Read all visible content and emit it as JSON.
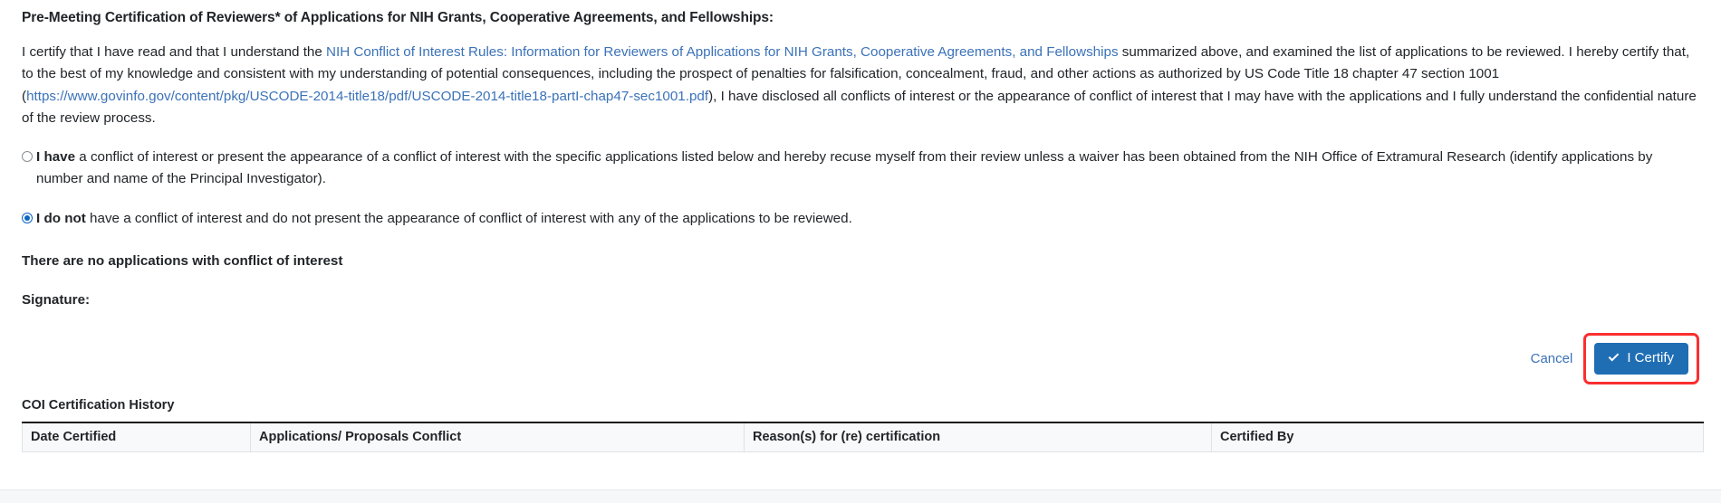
{
  "heading": "Pre-Meeting Certification of Reviewers* of Applications for NIH Grants, Cooperative Agreements, and Fellowships:",
  "certification": {
    "text_before_link": "I certify that I have read and that I understand the ",
    "policy_link": "NIH Conflict of Interest Rules: Information for Reviewers of Applications for NIH Grants, Cooperative Agreements, and Fellowships",
    "text_after_link": " summarized above, and examined the list of applications to be reviewed. I hereby certify that, to the best of my knowledge and consistent with my understanding of potential consequences, including the prospect of penalties for falsification, concealment, fraud, and other actions as authorized by US Code Title 18 chapter 47 section 1001 (",
    "uscode_link": "https://www.govinfo.gov/content/pkg/USCODE-2014-title18/pdf/USCODE-2014-title18-partI-chap47-sec1001.pdf",
    "text_tail": "), I have disclosed all conflicts of interest or the appearance of conflict of interest that I may have with the applications and I fully understand the confidential nature of the review process."
  },
  "options": [
    {
      "id": "i-have",
      "selected": false,
      "bold_lead": "I have",
      "rest": " a conflict of interest or present the appearance of a conflict of interest with the specific applications listed below and hereby recuse myself from their review unless a waiver has been obtained from the NIH Office of Extramural Research (identify applications by number and name of the Principal Investigator)."
    },
    {
      "id": "i-do-not",
      "selected": true,
      "bold_lead": "I do not",
      "rest": " have a conflict of interest and do not present the appearance of conflict of interest with any of the applications to be reviewed."
    }
  ],
  "no_conflict_message": "There are no applications with conflict of interest",
  "signature_label": "Signature:",
  "actions": {
    "cancel_label": "Cancel",
    "certify_label": "I Certify",
    "certify_icon": "check-icon",
    "certify_button_color": "#1f6eb4",
    "highlight_color": "#fb2e2e"
  },
  "history": {
    "title": "COI Certification History",
    "columns": [
      "Date Certified",
      "Applications/ Proposals Conflict",
      "Reason(s) for (re) certification",
      "Certified By"
    ],
    "rows": []
  },
  "colors": {
    "link": "#3b72b8",
    "text": "#212529",
    "radio_selected": "#0b65c2"
  }
}
